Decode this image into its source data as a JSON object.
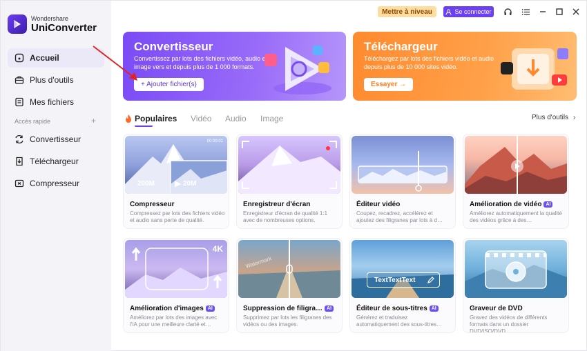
{
  "app": {
    "brand_small": "Wondershare",
    "brand_large": "UniConverter"
  },
  "topbar": {
    "upgrade_label": "Mettre à niveau",
    "login_label": "Se connecter",
    "icons": [
      "headset-icon",
      "menu-icon",
      "minimize-icon",
      "maximize-icon",
      "close-icon"
    ]
  },
  "sidebar": {
    "items": [
      {
        "label": "Accueil",
        "icon": "home-icon",
        "active": true
      },
      {
        "label": "Plus d'outils",
        "icon": "toolbox-icon"
      },
      {
        "label": "Mes fichiers",
        "icon": "files-icon"
      }
    ],
    "section_label": "Accès rapide",
    "quick": [
      {
        "label": "Convertisseur",
        "icon": "convert-icon"
      },
      {
        "label": "Téléchargeur",
        "icon": "download-icon"
      },
      {
        "label": "Compresseur",
        "icon": "compress-icon"
      }
    ]
  },
  "banners": {
    "converter": {
      "title": "Convertisseur",
      "desc": "Convertissez par lots des fichiers vidéo, audio et image vers et depuis plus de 1 000 formats.",
      "button": "+ Ajouter fichier(s)"
    },
    "downloader": {
      "title": "Téléchargeur",
      "desc": "Téléchargez par lots des fichiers vidéo et audio depuis plus de 10 000 sites vidéo.",
      "button": "Essayer →"
    }
  },
  "tabs": [
    "Populaires",
    "Vidéo",
    "Audio",
    "Image"
  ],
  "more_tools": "Plus d'outils",
  "cards": [
    {
      "title": "Compresseur",
      "desc": "Compressez par lots des fichiers vidéo et audio sans perte de qualité.",
      "ai": false,
      "thumb_left": "200M",
      "thumb_right": "20M",
      "thumb_time": "00:00:01"
    },
    {
      "title": "Enregistreur d'écran",
      "desc": "Enregistreur d'écran de qualité 1:1 avec de nombreuses options.",
      "ai": false
    },
    {
      "title": "Éditeur vidéo",
      "desc": "Coupez, recadrez, accélérez et ajoutez des filigranes par lots à d…",
      "ai": false
    },
    {
      "title": "Amélioration de vidéo",
      "desc": "Améliorez automatiquement la qualité des vidéos grâce à des…",
      "ai": true
    },
    {
      "title": "Amélioration d'images",
      "desc": "Améliorez par lots des images avec l'IA pour une meilleure clarté et…",
      "ai": true,
      "thumb_badge": "4K"
    },
    {
      "title": "Suppression de filigra…",
      "desc": "Supprimez par lots les filigranes des vidéos ou des images.",
      "ai": true,
      "thumb_text": "Watermark"
    },
    {
      "title": "Éditeur de sous-titres",
      "desc": "Générez et traduisez automatiquement des sous-titres…",
      "ai": true,
      "thumb_text": "TextTextText"
    },
    {
      "title": "Graveur de DVD",
      "desc": "Gravez des vidéos de différents formats dans un dossier DVD/ISO/DVD.",
      "ai": false
    }
  ],
  "ai_label": "AI",
  "colors": {
    "accent": "#6b3ff2",
    "orange": "#ff8a2e",
    "upgrade_bg": "#ffdca0"
  }
}
